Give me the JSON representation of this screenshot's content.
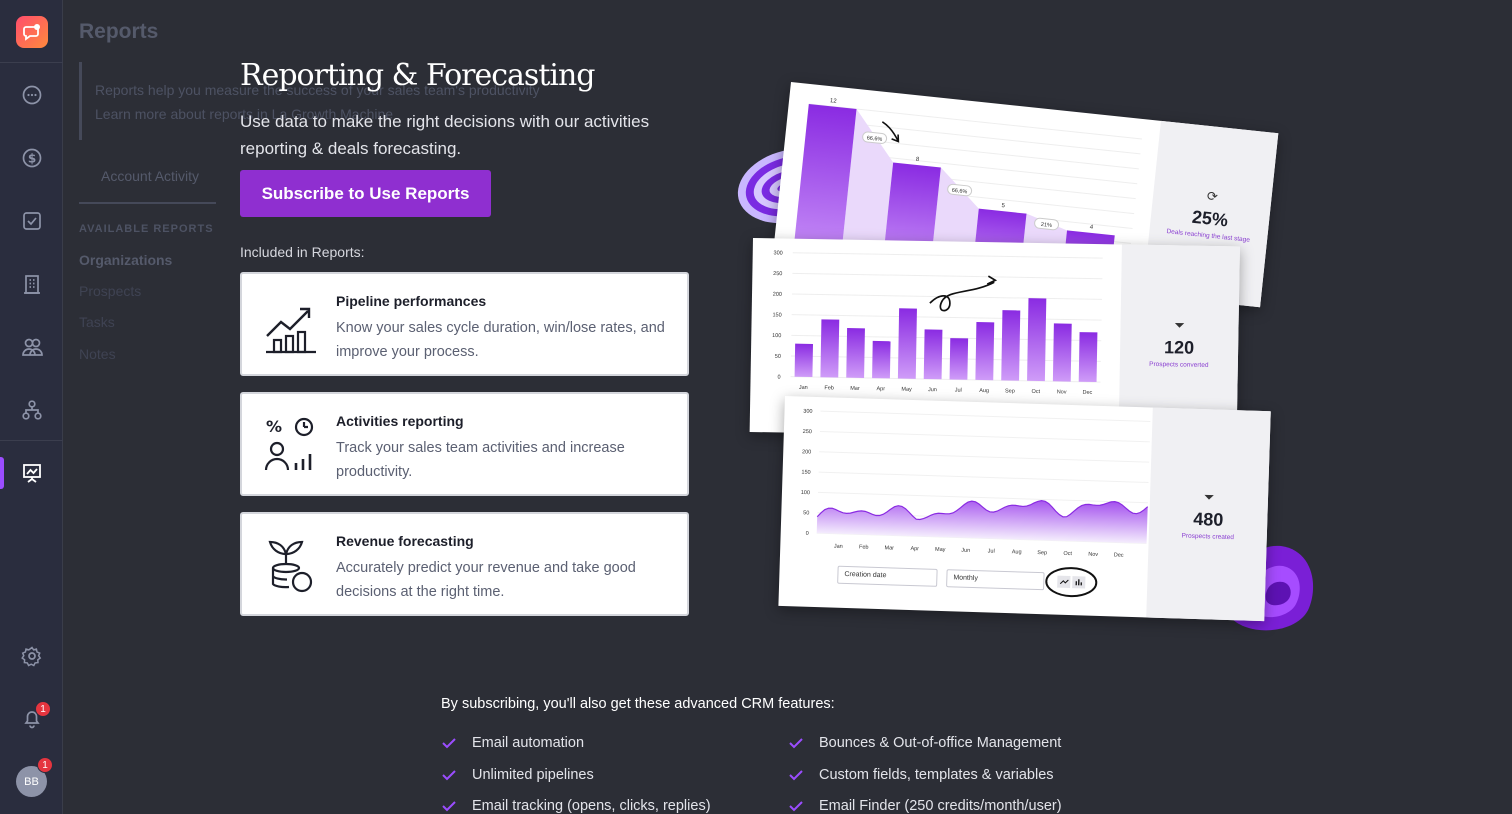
{
  "background_page": {
    "title": "Reports",
    "notice_line1": "Reports help you measure the success of your sales team's productivity",
    "notice_line2": "Learn more about reports in La Growth Machine",
    "tab": "Account Activity",
    "available_label": "AVAILABLE REPORTS",
    "items": [
      "Organizations",
      "Prospects",
      "Tasks",
      "Notes"
    ]
  },
  "sidebar": {
    "icons": [
      "chat-icon",
      "dollar-icon",
      "checkbox-icon",
      "building-icon",
      "people-icon",
      "hierarchy-icon",
      "reports-icon"
    ],
    "settings_icon": "gear-icon",
    "notifications_badge": "1",
    "avatar_initials": "BB",
    "avatar_badge": "1",
    "accent": "#9b4dff"
  },
  "modal": {
    "headline": "Reporting & Forecasting",
    "subtitle": "Use data to make the right decisions with our activities reporting & deals forecasting.",
    "cta_label": "Subscribe to Use Reports",
    "included_label": "Included in Reports:",
    "cards": [
      {
        "title": "Pipeline performances",
        "desc": "Know your sales cycle duration, win/lose rates, and improve your process.",
        "icon": "chart-growth-icon"
      },
      {
        "title": "Activities reporting",
        "desc": "Track your sales team activities and increase productivity.",
        "icon": "activities-icon"
      },
      {
        "title": "Revenue forecasting",
        "desc": "Accurately predict your revenue and take good decisions at the right time.",
        "icon": "plant-coins-icon"
      }
    ]
  },
  "illustration": {
    "funnel": {
      "stat": "25%",
      "label": "Deals reaching the last stage",
      "bars": [
        12,
        8,
        5,
        4
      ],
      "pcts": [
        "66,6%",
        "66,6%",
        "21%"
      ]
    },
    "bars": {
      "stat": "120",
      "label": "Prospects converted",
      "months": [
        "Jan",
        "Feb",
        "Mar",
        "Apr",
        "May",
        "Jun",
        "Jul",
        "Aug",
        "Sep",
        "Oct",
        "Nov",
        "Dec"
      ],
      "values": [
        80,
        140,
        120,
        90,
        170,
        120,
        100,
        140,
        170,
        200,
        140,
        120
      ],
      "yticks": [
        "300",
        "250",
        "200",
        "150",
        "100",
        "50",
        "0"
      ]
    },
    "area": {
      "stat": "480",
      "label": "Prospects created",
      "months": [
        "Jan",
        "Feb",
        "Mar",
        "Apr",
        "May",
        "Jun",
        "Jul",
        "Aug",
        "Sep",
        "Oct",
        "Nov",
        "Dec"
      ],
      "yticks": [
        "300",
        "250",
        "200",
        "150",
        "100",
        "50",
        "0"
      ],
      "select1": "Creation date",
      "select2": "Monthly"
    },
    "accent": "#9b3fe0"
  },
  "features": {
    "title": "By subscribing, you'll also get these advanced CRM features:",
    "left": [
      "Email automation",
      "Unlimited pipelines",
      "Email tracking (opens, clicks, replies)"
    ],
    "right": [
      "Bounces & Out-of-office Management",
      "Custom fields, templates & variables",
      "Email Finder (250 credits/month/user)"
    ],
    "check_color": "#9b4dff"
  }
}
